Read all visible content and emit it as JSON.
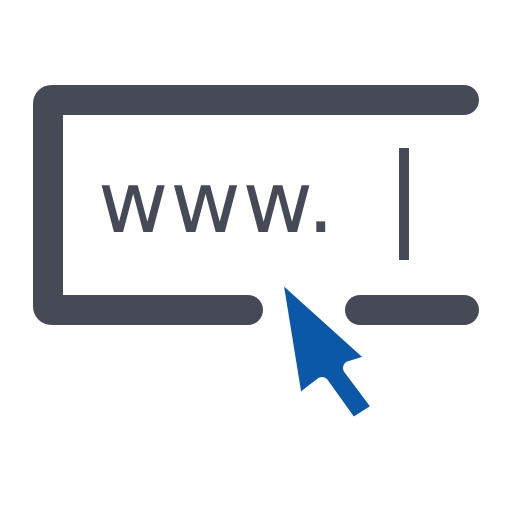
{
  "icon": {
    "name": "web-address-click-icon",
    "address_text": "www.",
    "colors": {
      "frame": "#464956",
      "text": "#464956",
      "caret": "#464956",
      "cursor": "#0B57A8",
      "background": "#ffffff"
    }
  }
}
